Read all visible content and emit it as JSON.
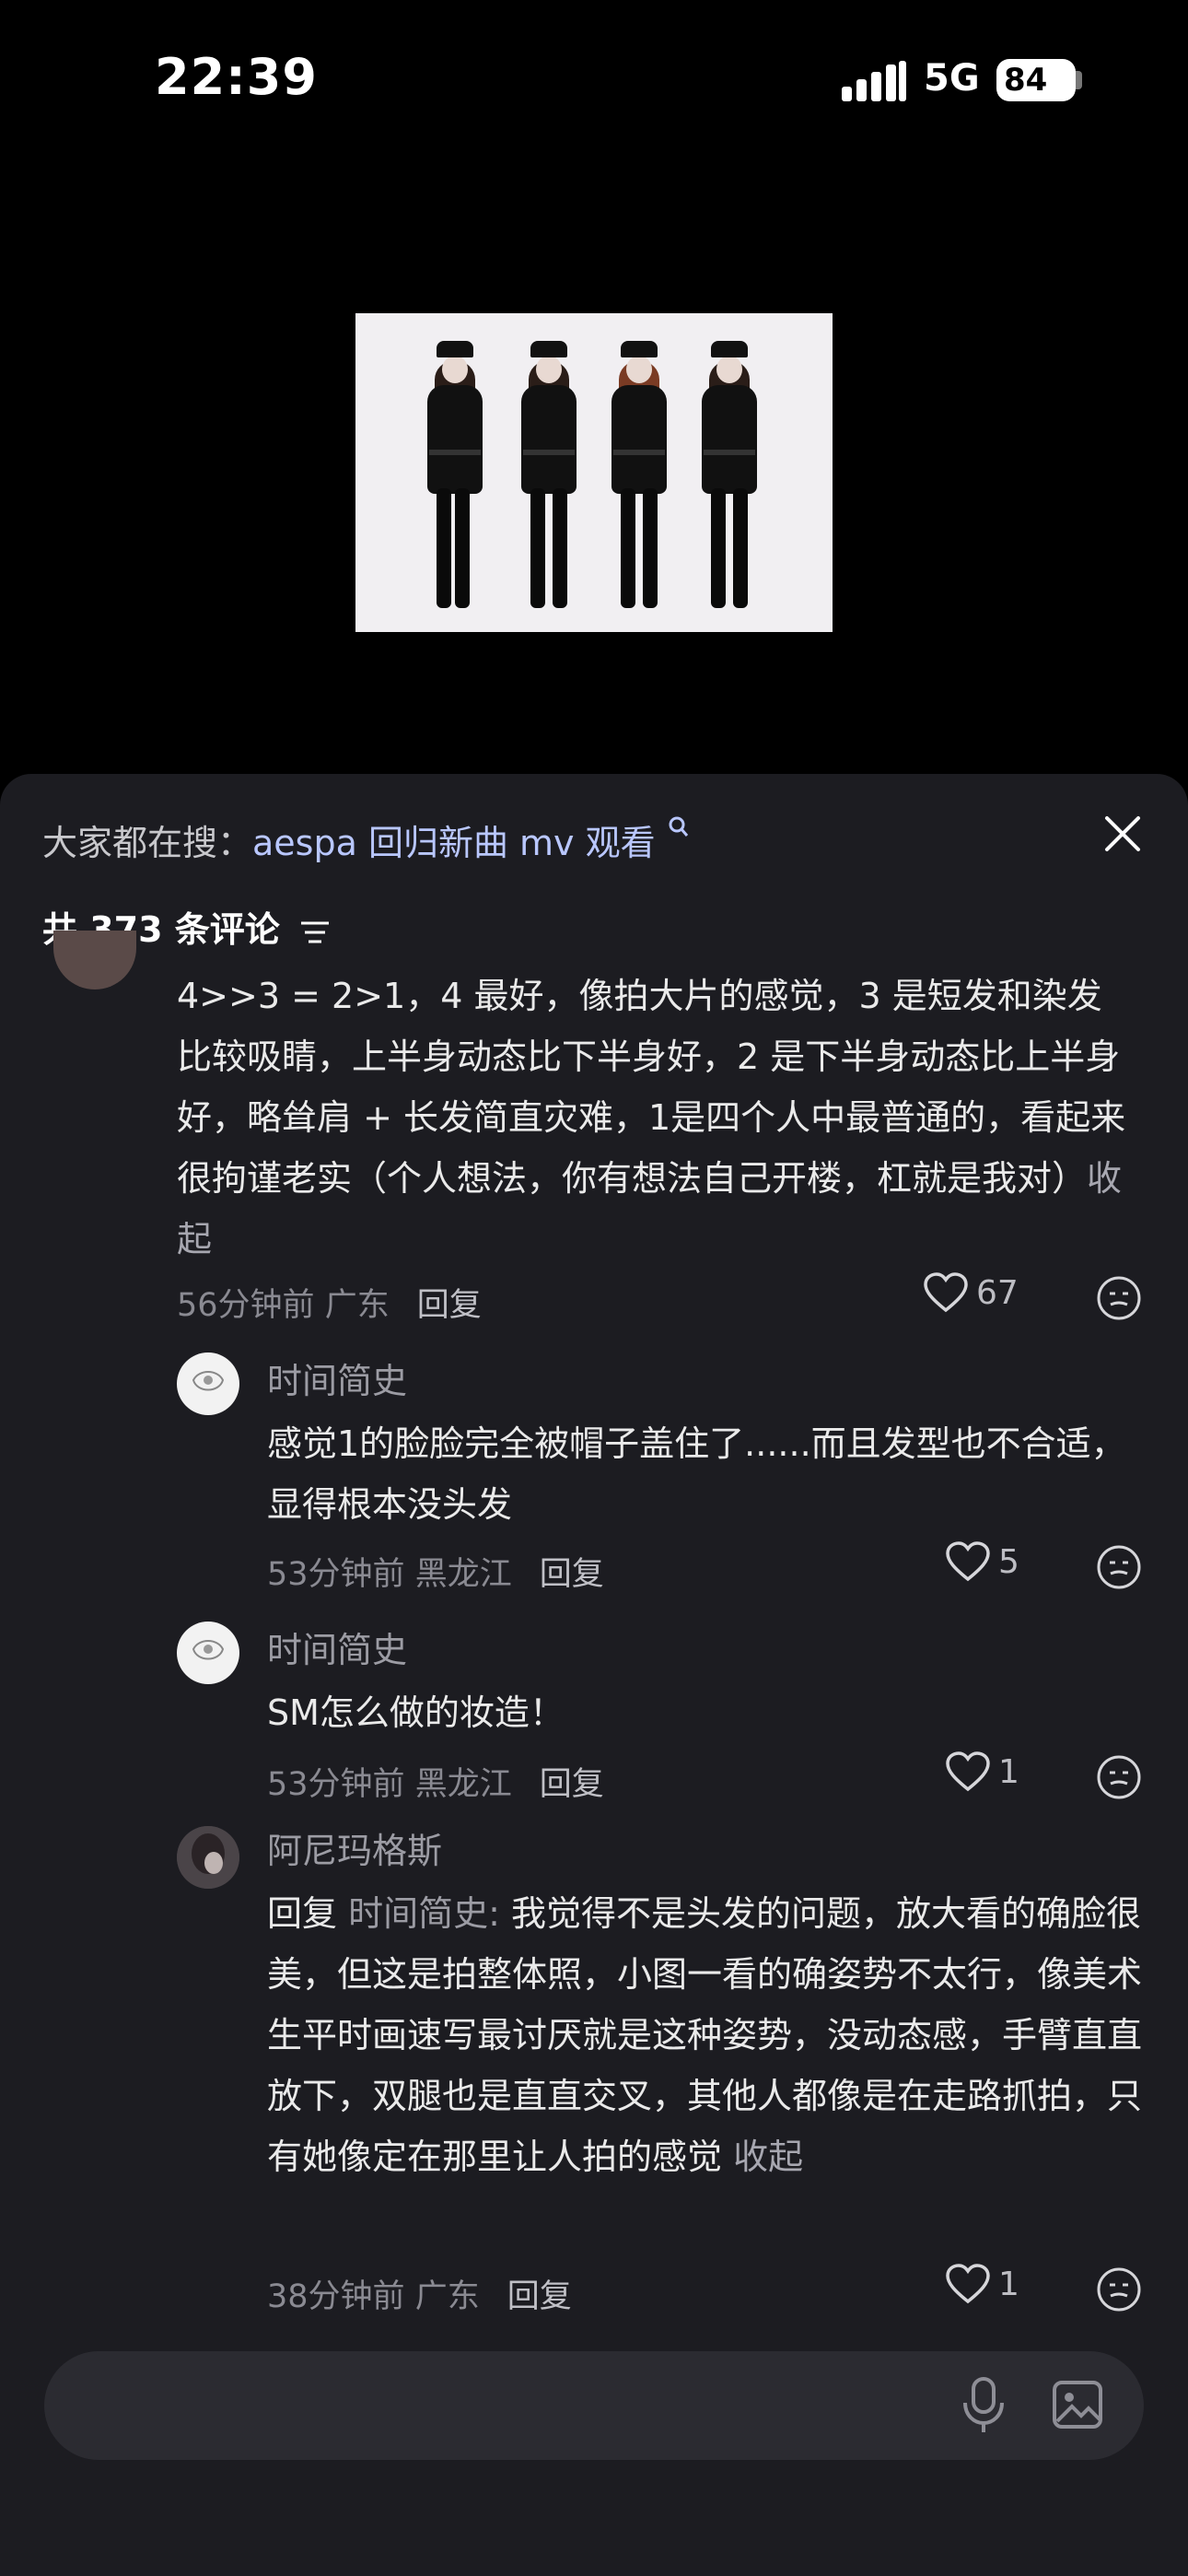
{
  "status": {
    "time": "22:39",
    "network": "5G",
    "battery": "84"
  },
  "search": {
    "prefix": "大家都在搜：",
    "keyword": "aespa 回归新曲 mv 观看"
  },
  "comments_header": {
    "count_label": "共 373 条评论"
  },
  "main_comment": {
    "text": "4>>3 = 2>1，4 最好，像拍大片的感觉，3 是短发和染发比较吸睛，上半身动态比下半身好，2 是下半身动态比上半身好，略耸肩 + 长发简直灾难，1是四个人中最普通的，看起来很拘谨老实（个人想法，你有想法自己开楼，杠就是我对）",
    "collapse": "收起",
    "time": "56分钟前",
    "location": "广东",
    "reply": "回复",
    "likes": "67"
  },
  "replies": [
    {
      "name": "时间简史",
      "text": "感觉1的脸脸完全被帽子盖住了......而且发型也不合适，显得根本没头发",
      "time": "53分钟前",
      "location": "黑龙江",
      "reply": "回复",
      "likes": "5"
    },
    {
      "name": "时间简史",
      "text": "SM怎么做的妆造！",
      "time": "53分钟前",
      "location": "黑龙江",
      "reply": "回复",
      "likes": "1"
    },
    {
      "name": "阿尼玛格斯",
      "reply_prefix": "回复",
      "reply_to": "时间简史:",
      "text": "我觉得不是头发的问题，放大看的确脸很美，但这是拍整体照，小图一看的确姿势不太行，像美术生平时画速写最讨厌就是这种姿势，没动态感，手臂直直放下，双腿也是直直交叉，其他人都像是在走路抓拍，只有她像定在那里让人拍的感觉",
      "collapse": "收起",
      "time": "38分钟前",
      "location": "广东",
      "reply": "回复",
      "likes": "1"
    }
  ],
  "input": {
    "placeholder": ""
  },
  "colors": {
    "sheet": "#1c1c21",
    "keyword": "#b9c7ff",
    "muted": "#8a8a92"
  }
}
